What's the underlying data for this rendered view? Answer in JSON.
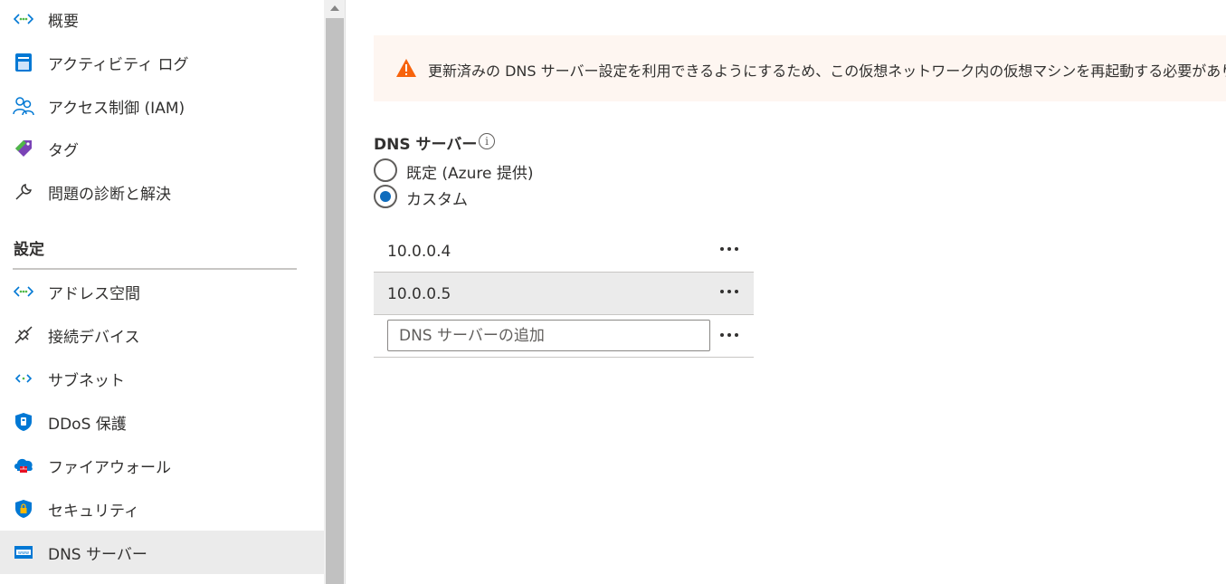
{
  "sidebar": {
    "items_top": [
      {
        "label": "概要",
        "icon": "vnet-icon"
      },
      {
        "label": "アクティビティ ログ",
        "icon": "activity-log-icon"
      },
      {
        "label": "アクセス制御 (IAM)",
        "icon": "iam-icon"
      },
      {
        "label": "タグ",
        "icon": "tag-icon"
      },
      {
        "label": "問題の診断と解決",
        "icon": "wrench-icon"
      }
    ],
    "section_header": "設定",
    "items_settings": [
      {
        "label": "アドレス空間",
        "icon": "address-space-icon"
      },
      {
        "label": "接続デバイス",
        "icon": "plug-icon"
      },
      {
        "label": "サブネット",
        "icon": "subnet-icon"
      },
      {
        "label": "DDoS 保護",
        "icon": "ddos-shield-icon"
      },
      {
        "label": "ファイアウォール",
        "icon": "firewall-icon"
      },
      {
        "label": "セキュリティ",
        "icon": "security-shield-icon"
      },
      {
        "label": "DNS サーバー",
        "icon": "dns-server-icon"
      }
    ],
    "selected": "DNS サーバー"
  },
  "main": {
    "warning_text": "更新済みの DNS サーバー設定を利用できるようにするため、この仮想ネットワーク内の仮想マシンを再起動する必要があります。",
    "dns_label": "DNS サーバー",
    "info_glyph": "i",
    "radio_default": "既定 (Azure 提供)",
    "radio_custom": "カスタム",
    "selected_option": "カスタム",
    "dns_servers": [
      "10.0.0.4",
      "10.0.0.5"
    ],
    "add_placeholder": "DNS サーバーの追加"
  },
  "colors": {
    "accent": "#0f6cbd",
    "warning_bg": "#fef6f1",
    "warning_icon": "#f7630c",
    "selected_bg": "#ebebeb"
  }
}
